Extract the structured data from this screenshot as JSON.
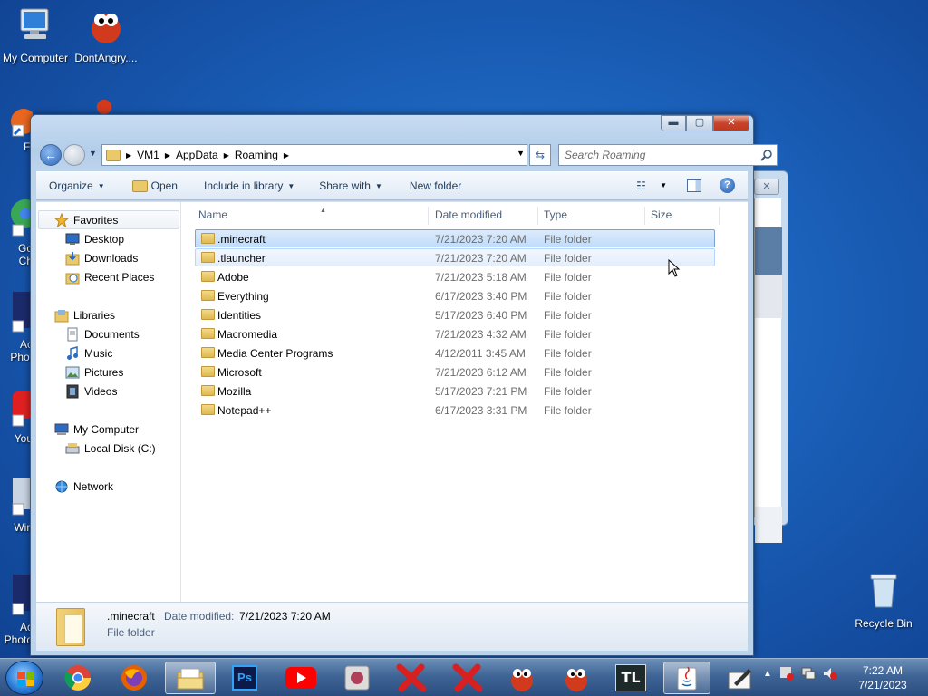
{
  "desktop": {
    "icons": [
      {
        "label": "My Computer"
      },
      {
        "label": "DontAngry...."
      },
      {
        "label": "Recycle Bin"
      }
    ],
    "partial_labels": [
      "Fi",
      "Go",
      "Ch",
      "Ac",
      "Phot",
      "You",
      "Win",
      "Ac",
      "Photo"
    ]
  },
  "window": {
    "breadcrumbs": [
      "VM1",
      "AppData",
      "Roaming"
    ],
    "search_placeholder": "Search Roaming",
    "toolbar": {
      "organize": "Organize",
      "open": "Open",
      "include_in_library": "Include in library",
      "share_with": "Share with",
      "new_folder": "New folder"
    },
    "nav": {
      "favorites": "Favorites",
      "favorites_items": [
        "Desktop",
        "Downloads",
        "Recent Places"
      ],
      "libraries": "Libraries",
      "libraries_items": [
        "Documents",
        "Music",
        "Pictures",
        "Videos"
      ],
      "computer": "My Computer",
      "computer_items": [
        "Local Disk (C:)"
      ],
      "network": "Network"
    },
    "columns": {
      "name": "Name",
      "date_modified": "Date modified",
      "type": "Type",
      "size": "Size"
    },
    "files": [
      {
        "name": ".minecraft",
        "date": "7/21/2023 7:20 AM",
        "type": "File folder",
        "state": "selected"
      },
      {
        "name": ".tlauncher",
        "date": "7/21/2023 7:20 AM",
        "type": "File folder",
        "state": "hover"
      },
      {
        "name": "Adobe",
        "date": "7/21/2023 5:18 AM",
        "type": "File folder",
        "state": ""
      },
      {
        "name": "Everything",
        "date": "6/17/2023 3:40 PM",
        "type": "File folder",
        "state": ""
      },
      {
        "name": "Identities",
        "date": "5/17/2023 6:40 PM",
        "type": "File folder",
        "state": ""
      },
      {
        "name": "Macromedia",
        "date": "7/21/2023 4:32 AM",
        "type": "File folder",
        "state": ""
      },
      {
        "name": "Media Center Programs",
        "date": "4/12/2011 3:45 AM",
        "type": "File folder",
        "state": ""
      },
      {
        "name": "Microsoft",
        "date": "7/21/2023 6:12 AM",
        "type": "File folder",
        "state": ""
      },
      {
        "name": "Mozilla",
        "date": "5/17/2023 7:21 PM",
        "type": "File folder",
        "state": ""
      },
      {
        "name": "Notepad++",
        "date": "6/17/2023 3:31 PM",
        "type": "File folder",
        "state": ""
      }
    ],
    "details": {
      "name": ".minecraft",
      "date_label": "Date modified:",
      "date_value": "7/21/2023 7:20 AM",
      "type": "File folder"
    }
  },
  "taskbar": {
    "apps": [
      "chrome-icon",
      "firefox-icon",
      "explorer-icon",
      "photoshop-icon",
      "youtube-icon",
      "app-icon",
      "x-icon",
      "x-icon",
      "dontangry-icon",
      "dontangry-icon",
      "tlauncher-icon",
      "java-icon"
    ],
    "tl_label": "TL",
    "ps_label": "Ps",
    "time": "7:22 AM",
    "date": "7/21/2023"
  }
}
